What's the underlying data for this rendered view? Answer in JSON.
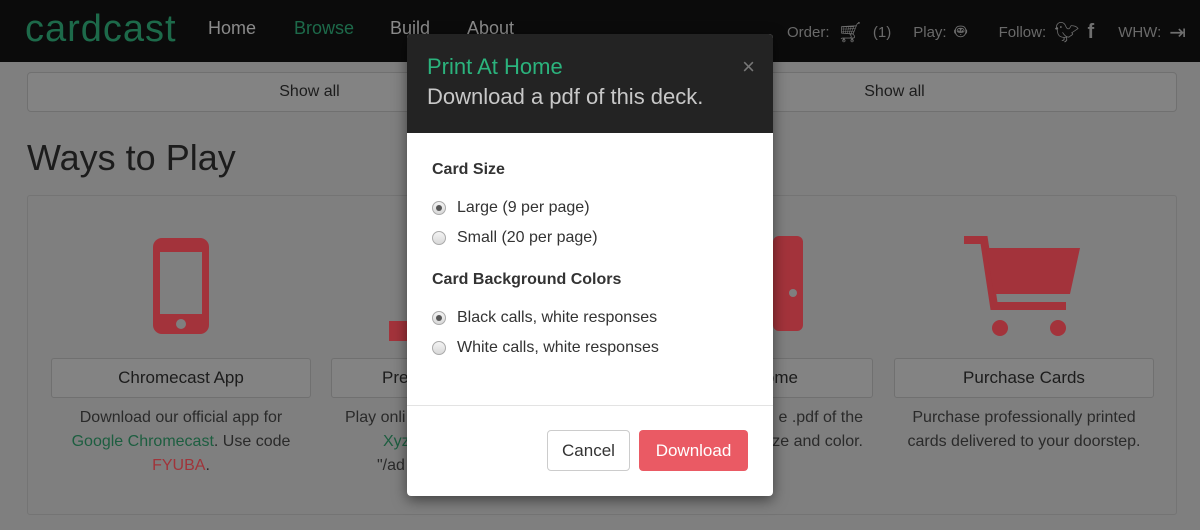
{
  "nav": {
    "logo": "cardcast",
    "links": [
      "Home",
      "Browse",
      "Build",
      "About"
    ],
    "active": "Browse",
    "order_label": "Order:",
    "cart_count": "(1)",
    "play_label": "Play:",
    "follow_label": "Follow:",
    "whw_label": "WHW:"
  },
  "show_all": [
    "Show all",
    "Show all"
  ],
  "section_title": "Ways to Play",
  "colors": {
    "accent_green": "#2bb37d",
    "brand_red": "#ea5a64"
  },
  "cards": [
    {
      "icon": "phone-icon",
      "button": "Chromecast App",
      "desc1": "Download our official app for",
      "link": "Google Chromecast",
      "desc2": ". Use code",
      "code": "FYUBA",
      "desc3": "."
    },
    {
      "icon": "laptop-icon",
      "button": "Pre",
      "desc1": "Play onli",
      "link": "Xyz",
      "desc3": "\"/ad"
    },
    {
      "icon": "printer-icon",
      "button": "ome",
      "desc1": "e .pdf of the",
      "desc2": "ze and color."
    },
    {
      "icon": "cart-icon",
      "button": "Purchase Cards",
      "desc1": "Purchase professionally printed",
      "desc2": "cards delivered to your doorstep."
    }
  ],
  "modal": {
    "title": "Print At Home",
    "subtitle": "Download a pdf of this deck.",
    "close": "×",
    "size_label": "Card Size",
    "size_options": [
      "Large (9 per page)",
      "Small (20 per page)"
    ],
    "size_selected": "Large (9 per page)",
    "color_label": "Card Background Colors",
    "color_options": [
      "Black calls, white responses",
      "White calls, white responses"
    ],
    "color_selected": "Black calls, white responses",
    "cancel": "Cancel",
    "download": "Download"
  }
}
